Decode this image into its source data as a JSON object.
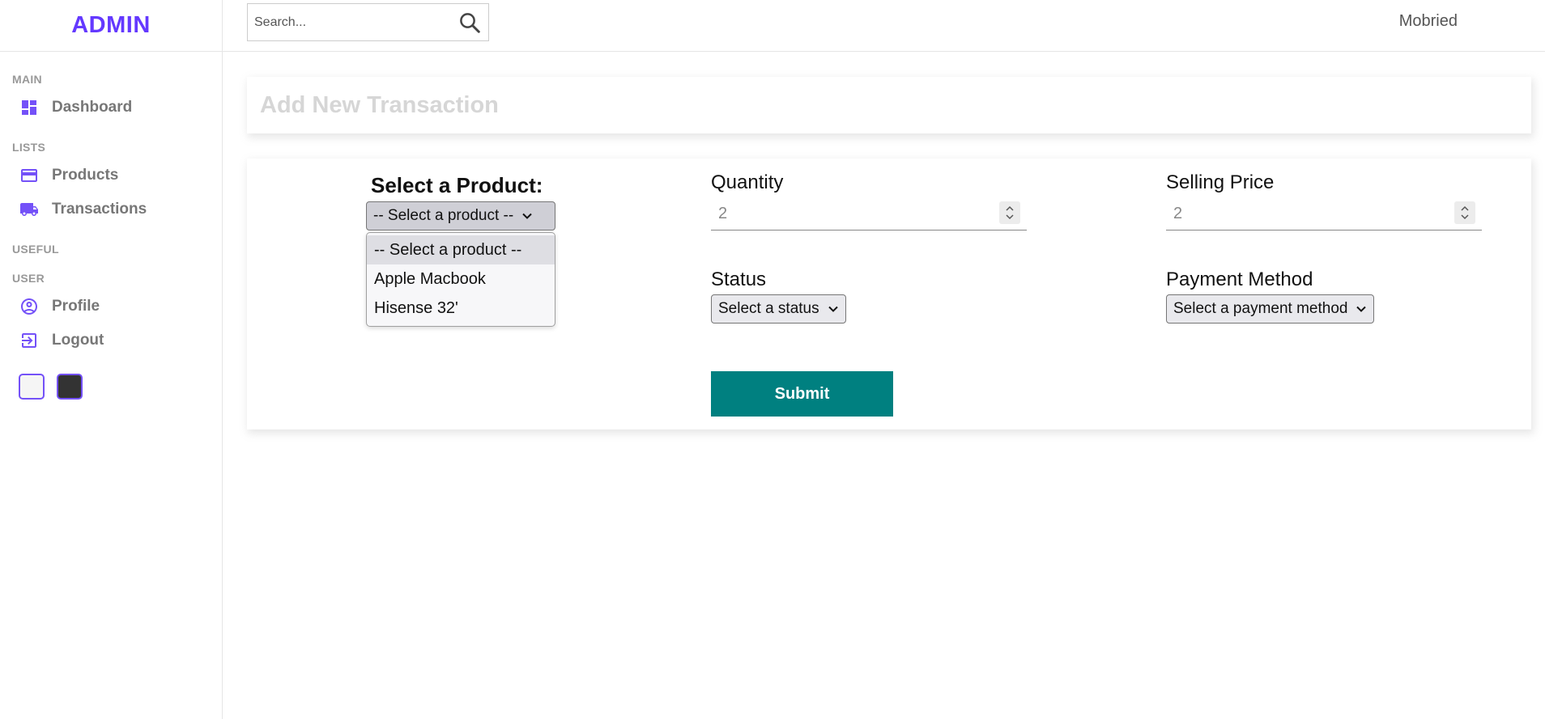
{
  "brand": {
    "title": "ADMIN",
    "accent_color": "#6439ff"
  },
  "sidebar": {
    "sections": [
      {
        "title": "MAIN"
      },
      {
        "title": "LISTS"
      },
      {
        "title": "USEFUL"
      },
      {
        "title": "USER"
      }
    ],
    "items": [
      {
        "label": "Dashboard",
        "icon": "dashboard-icon"
      },
      {
        "label": "Products",
        "icon": "credit-card-icon"
      },
      {
        "label": "Transactions",
        "icon": "truck-icon"
      },
      {
        "label": "Profile",
        "icon": "account-circle-icon"
      },
      {
        "label": "Logout",
        "icon": "logout-icon"
      }
    ],
    "theme_colors": {
      "light": "#f5f5f5",
      "dark": "#333333"
    }
  },
  "topbar": {
    "search_placeholder": "Search...",
    "search_icon": "search-icon",
    "user_name": "Mobried"
  },
  "page": {
    "title": "Add New Transaction"
  },
  "form": {
    "product": {
      "label": "Select a Product:",
      "selected": "-- Select a product --",
      "options": [
        "-- Select a product --",
        "Apple Macbook",
        "Hisense 32'"
      ]
    },
    "quantity": {
      "label": "Quantity",
      "value": "2"
    },
    "selling_price": {
      "label": "Selling Price",
      "value": "2"
    },
    "status": {
      "label": "Status",
      "selected": "Select a status"
    },
    "payment_method": {
      "label": "Payment Method",
      "selected": "Select a payment method"
    },
    "submit_label": "Submit",
    "submit_color": "#008080"
  }
}
